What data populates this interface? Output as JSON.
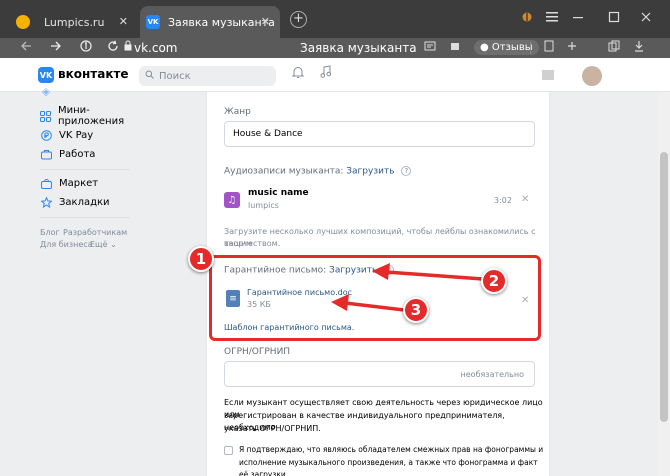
{
  "browser": {
    "tabs": [
      {
        "label": "Lumpics.ru",
        "active": false
      },
      {
        "label": "Заявка музыканта",
        "active": true
      }
    ],
    "favicon_vk": "VK",
    "close_glyph": "✕",
    "newtab_glyph": "+",
    "url": "vk.com",
    "page_title": "Заявка музыканта",
    "reviews_label": "Отзывы",
    "icons": [
      "back-icon",
      "forward-icon",
      "yandex-icon",
      "reload-icon",
      "lock-icon",
      "bookmark-icon",
      "download-icon"
    ]
  },
  "header": {
    "logo_mark": "VK",
    "logo_text": "вконтакте",
    "search_placeholder": "Поиск"
  },
  "sidebar": {
    "items": [
      {
        "label": "Мини-приложения",
        "icon": "grid-icon"
      },
      {
        "label": "VK Pay",
        "icon": "pay-icon"
      },
      {
        "label": "Работа",
        "icon": "briefcase-icon"
      },
      {
        "label": "Маркет",
        "icon": "bag-icon"
      },
      {
        "label": "Закладки",
        "icon": "star-icon"
      }
    ],
    "footer_links": [
      "Блог",
      "Разработчикам",
      "Для бизнеса",
      "Ещё"
    ]
  },
  "form": {
    "genre_label": "Жанр",
    "genre_value": "House & Dance",
    "audio_label": "Аудиозаписи музыканта:",
    "upload_label": "Загрузить",
    "track": {
      "title": "music name",
      "artist": "lumpics",
      "duration": "3:02"
    },
    "audio_hint_1": "Загрузите несколько лучших композиций, чтобы лейблы ознакомились с вашим",
    "audio_hint_2": "творчеством.",
    "letter_label": "Гарантийное письмо:",
    "letter_upload": "Загрузить",
    "doc": {
      "name": "Гарантийное письмо.doc",
      "size": "35 КБ"
    },
    "template_link": "Шаблон гарантийного письма.",
    "ogrn_label": "ОГРН/ОГРНИП",
    "ogrn_placeholder": "необязательно",
    "ogrn_hint_1": "Если музыкант осуществляет свою деятельность через юридическое лицо или",
    "ogrn_hint_2": "зарегистрирован в качестве индивидуального предпринимателя, необходимо",
    "ogrn_hint_3": "указать ОГРН/ОГРНИП.",
    "confirm_1": "Я подтверждаю, что являюсь обладателем смежных прав на фонограммы и",
    "confirm_2": "исполнение музыкального произведения, а также что фонограмма и факт её загрузки"
  },
  "annotations": {
    "badges": [
      "1",
      "2",
      "3"
    ],
    "color": "#e52a2a"
  },
  "colors": {
    "vk_blue": "#2787f5",
    "link": "#2a5885",
    "page_bg": "#edeef0"
  }
}
